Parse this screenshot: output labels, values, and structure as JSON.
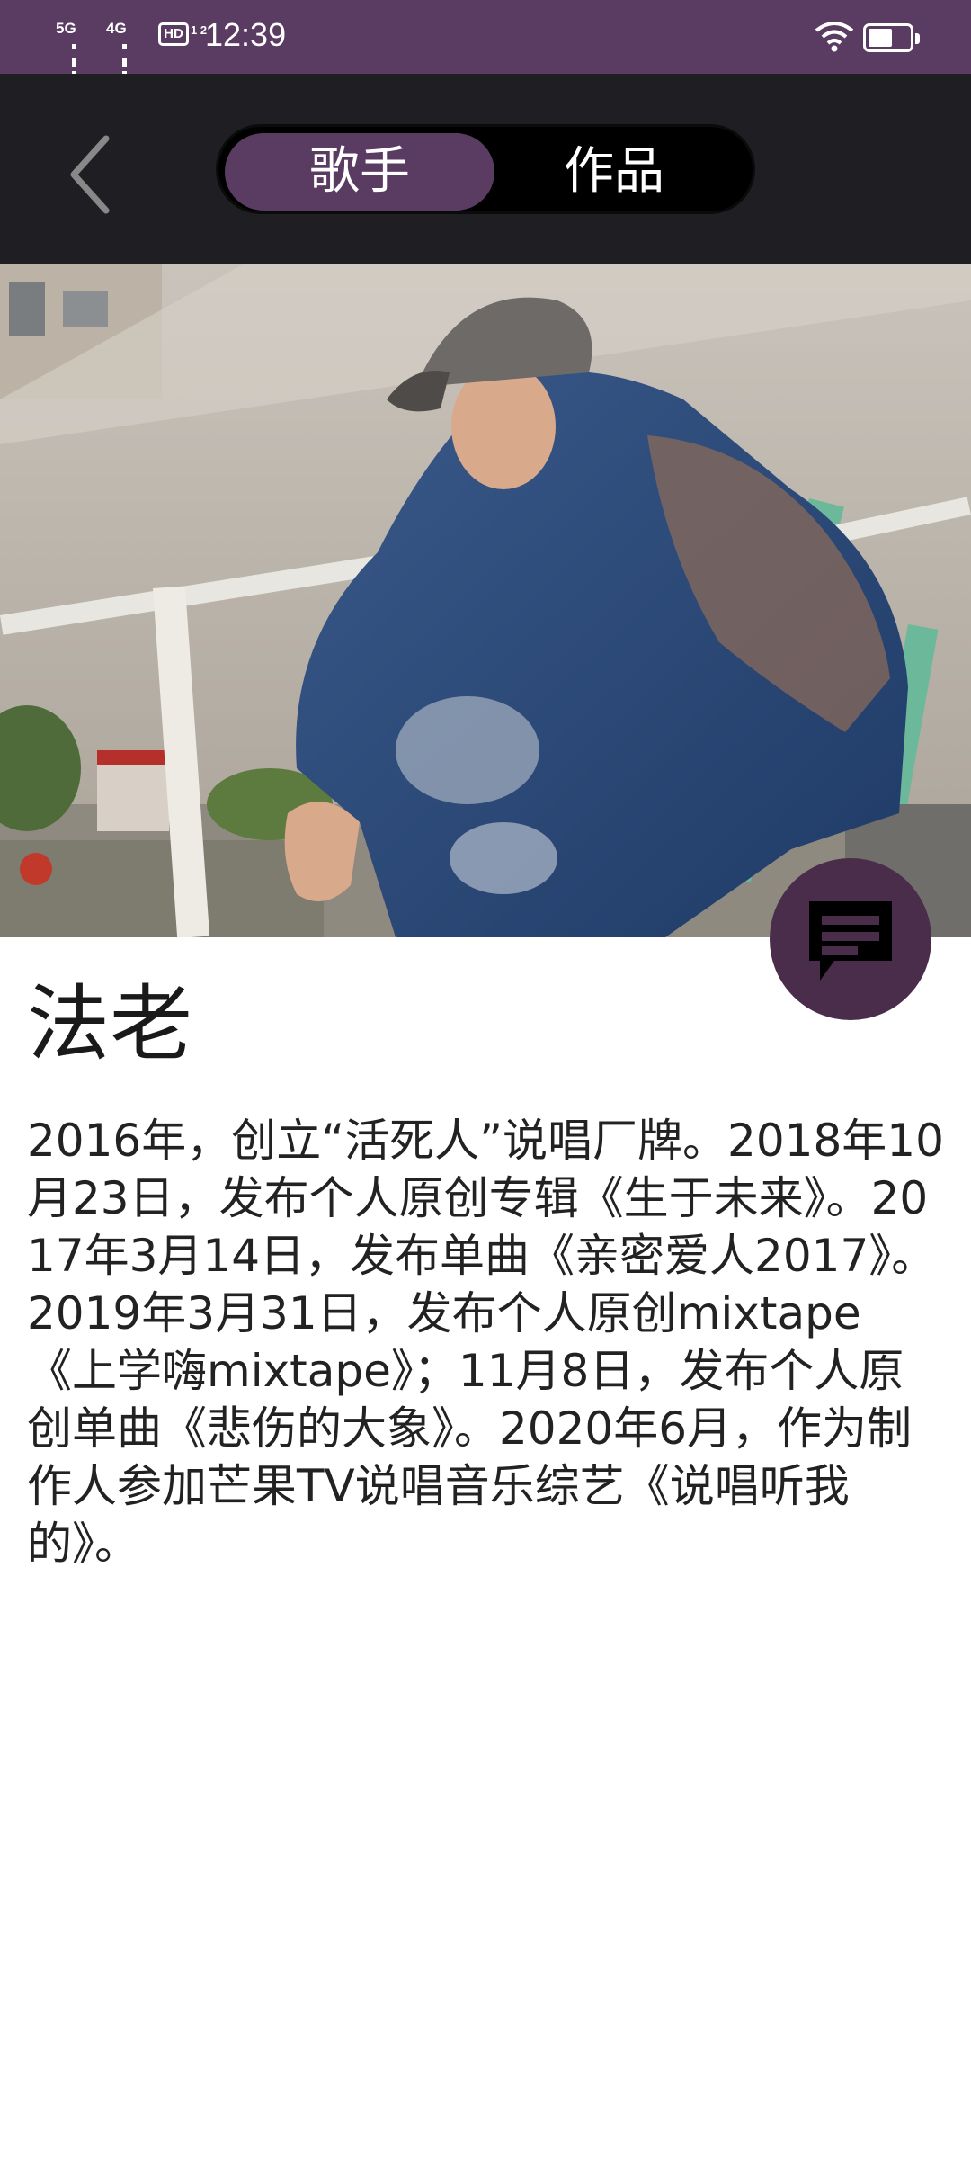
{
  "status_bar": {
    "signal1_label": "5G",
    "signal2_label": "4G",
    "hd_label": "HD",
    "hd_sub": "1 2",
    "time": "12:39",
    "battery_level": 0.6
  },
  "header": {
    "tabs": [
      {
        "label": "歌手",
        "selected": true
      },
      {
        "label": "作品",
        "selected": false
      }
    ]
  },
  "artist": {
    "name": "法老",
    "bio": "2016年，创立“活死人”说唱厂牌。2018年10月23日，发布个人原创专辑《生于未来》。2017年3月14日，发布单曲《亲密爱人2017》。2019年3月31日，发布个人原创mixtape《上学嗨mixtape》；11月8日，发布个人原创单曲《悲伤的大象》。2020年6月，作为制作人参加芒果TV说唱音乐综艺《说唱听我的》。"
  },
  "colors": {
    "accent": "#5a3b62",
    "app_bar": "#1f1e23",
    "fab": "#4a2d4a"
  },
  "icons": [
    "back-arrow-icon",
    "comment-icon",
    "wifi-icon",
    "battery-icon"
  ]
}
